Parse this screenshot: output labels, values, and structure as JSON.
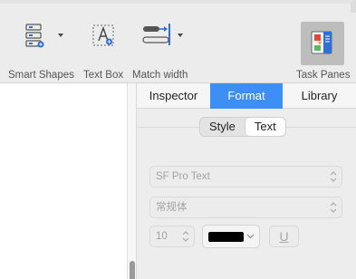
{
  "toolbar": {
    "smart_shapes_label": "Smart Shapes",
    "text_box_label": "Text Box",
    "match_width_label": "Match width",
    "task_panes_label": "Task Panes"
  },
  "inspector": {
    "tabs": [
      {
        "label": "Inspector"
      },
      {
        "label": "Format",
        "active": true
      },
      {
        "label": "Library"
      }
    ],
    "segments": [
      {
        "label": "Style"
      },
      {
        "label": "Text",
        "selected": true
      }
    ],
    "font_family": "SF Pro Text",
    "font_style": "常规体",
    "font_size": "10",
    "text_color": "#000000",
    "underline_glyph": "U"
  },
  "colors": {
    "accent": "#3d8ef5",
    "icon_blue": "#2f6fd6"
  }
}
